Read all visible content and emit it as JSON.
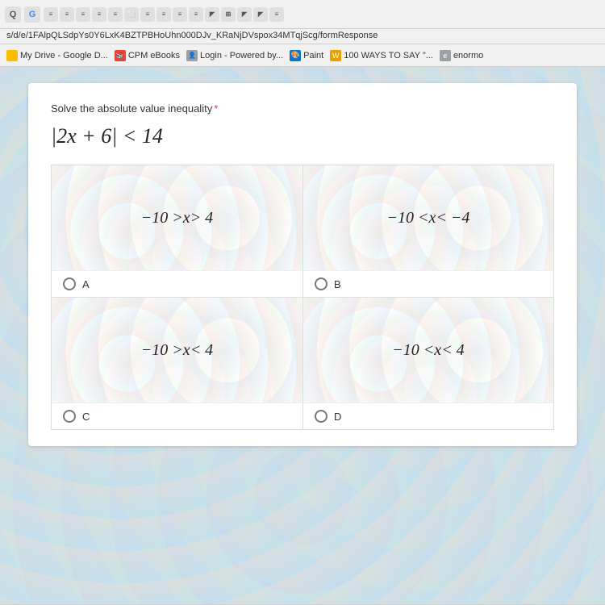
{
  "browser": {
    "address": "s/d/e/1FAlpQLSdpYs0Y6LxK4BZTPBHoUhn000DJv_KRaNjDVspox34MTqjScg/formResponse",
    "bookmarks": [
      {
        "label": "My Drive - Google D...",
        "color": "#fbbc04",
        "icon": "drive"
      },
      {
        "label": "CPM eBooks",
        "color": "#ea4335",
        "icon": "cpm"
      },
      {
        "label": "Login - Powered by...",
        "color": "#9aa0a6",
        "icon": "login"
      },
      {
        "label": "Paint",
        "color": "#0078d7",
        "icon": "paint"
      },
      {
        "label": "100 WAYS TO SAY \"...",
        "color": "#e8a000",
        "icon": "ways"
      },
      {
        "label": "enormo",
        "color": "#9aa0a6",
        "icon": "eno"
      }
    ]
  },
  "form": {
    "question": "Solve the absolute value inequality",
    "required_star": "*",
    "equation": "|2x + 6| < 14",
    "options": [
      {
        "id": "A",
        "math": "−10 > x > 4",
        "letter": "A"
      },
      {
        "id": "B",
        "math": "−10 < x < −4",
        "letter": "B"
      },
      {
        "id": "C",
        "math": "−10 > x < 4",
        "letter": "C"
      },
      {
        "id": "D",
        "math": "−10 < x < 4",
        "letter": "D"
      }
    ]
  }
}
